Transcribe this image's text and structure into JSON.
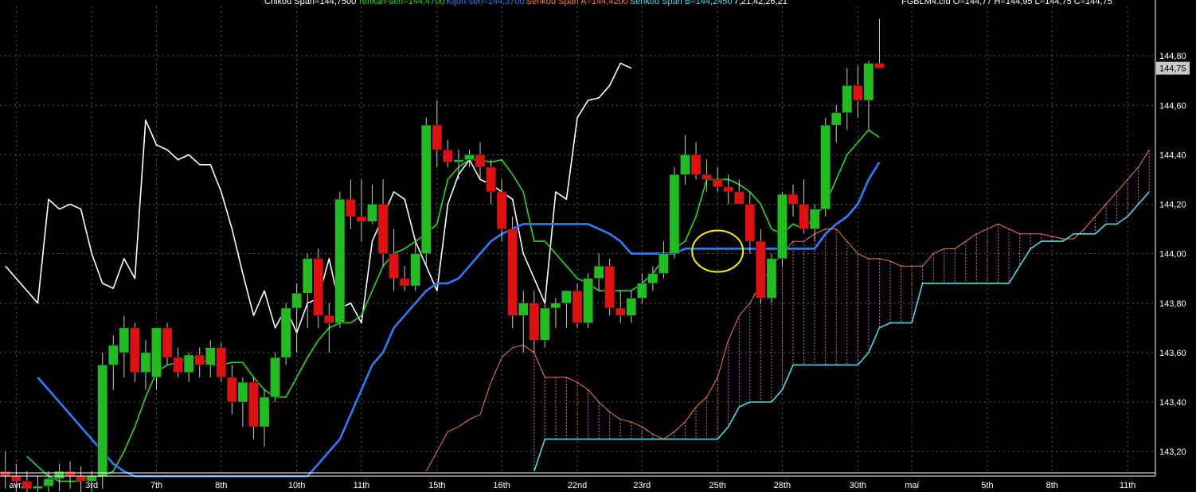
{
  "legend": {
    "chikou": "Chikou Span=144,7500",
    "tenkan": "Tenkan-sen=144,4700",
    "kijun": "Kijun-sen=144,3700",
    "senkou_a": "Senkou Span A=144,4200",
    "senkou_b": "Senkou Span B=144,2450",
    "params": "7,21,42,26,21",
    "ohlc": "FGBLM4.cfd O=144,77 H=144,95 L=144,75 C=144,75"
  },
  "last_price_label": "144,75",
  "colors": {
    "background": "#000000",
    "grid": "#5a5a5a",
    "chikou": "#ffffff",
    "tenkan": "#22dd22",
    "kijun": "#2a7fff",
    "senkou_a": "#ff7744",
    "senkou_b": "#44ddee",
    "cloud_fill": "#cc66cc",
    "candle_up": "#22bb22",
    "candle_down": "#dd1111",
    "highlight_circle": "#ffee00"
  },
  "chart_data": {
    "type": "candlestick",
    "y_tick_labels": [
      "144,80",
      "144,60",
      "144,40",
      "144,20",
      "144,00",
      "143,80",
      "143,60",
      "143,40",
      "143,20"
    ],
    "ylim": [
      143.12,
      145.0
    ],
    "x_tick_labels": [
      "avr.",
      "3rd",
      "7th",
      "8th",
      "10th",
      "11th",
      "15th",
      "16th",
      "22nd",
      "23rd",
      "25th",
      "28th",
      "30th",
      "mai",
      "5th",
      "8th",
      "11th"
    ],
    "x_tick_bar_index": [
      1,
      8,
      14,
      20,
      27,
      33,
      40,
      46,
      53,
      59,
      66,
      72,
      79,
      84,
      91,
      97,
      104
    ],
    "bar_count": 107,
    "grid": true,
    "candles": [
      [
        143.12,
        143.2,
        143.05,
        143.1
      ],
      [
        143.1,
        143.15,
        143.02,
        143.08
      ],
      [
        143.08,
        143.12,
        143.0,
        143.05
      ],
      [
        143.05,
        143.1,
        143.0,
        143.06
      ],
      [
        143.06,
        143.12,
        143.02,
        143.09
      ],
      [
        143.09,
        143.15,
        143.04,
        143.12
      ],
      [
        143.12,
        143.16,
        143.05,
        143.1
      ],
      [
        143.1,
        143.14,
        143.03,
        143.08
      ],
      [
        143.08,
        143.12,
        143.02,
        143.1
      ],
      [
        143.1,
        143.6,
        143.05,
        143.55
      ],
      [
        143.55,
        143.67,
        143.45,
        143.63
      ],
      [
        143.6,
        143.75,
        143.5,
        143.7
      ],
      [
        143.7,
        143.72,
        143.48,
        143.52
      ],
      [
        143.52,
        143.65,
        143.45,
        143.6
      ],
      [
        143.5,
        143.7,
        143.45,
        143.7
      ],
      [
        143.7,
        143.72,
        143.55,
        143.58
      ],
      [
        143.58,
        143.62,
        143.5,
        143.52
      ],
      [
        143.52,
        143.6,
        143.48,
        143.59
      ],
      [
        143.59,
        143.62,
        143.5,
        143.55
      ],
      [
        143.55,
        143.65,
        143.5,
        143.62
      ],
      [
        143.62,
        143.64,
        143.48,
        143.5
      ],
      [
        143.5,
        143.55,
        143.35,
        143.4
      ],
      [
        143.4,
        143.5,
        143.3,
        143.48
      ],
      [
        143.48,
        143.5,
        143.25,
        143.3
      ],
      [
        143.3,
        143.45,
        143.22,
        143.42
      ],
      [
        143.42,
        143.6,
        143.4,
        143.58
      ],
      [
        143.58,
        143.8,
        143.55,
        143.78
      ],
      [
        143.78,
        143.88,
        143.6,
        143.84
      ],
      [
        143.84,
        144.0,
        143.7,
        143.98
      ],
      [
        143.98,
        144.02,
        143.7,
        143.75
      ],
      [
        143.75,
        143.8,
        143.6,
        143.72
      ],
      [
        143.72,
        144.25,
        143.7,
        144.22
      ],
      [
        144.22,
        144.3,
        144.1,
        144.15
      ],
      [
        144.15,
        144.3,
        144.05,
        144.13
      ],
      [
        144.13,
        144.28,
        144.12,
        144.2
      ],
      [
        144.2,
        144.3,
        143.95,
        144.0
      ],
      [
        144.0,
        144.1,
        143.85,
        143.9
      ],
      [
        143.9,
        143.95,
        143.85,
        143.87
      ],
      [
        143.87,
        144.05,
        143.85,
        144.0
      ],
      [
        144.0,
        144.55,
        143.95,
        144.52
      ],
      [
        144.52,
        144.62,
        144.35,
        144.42
      ],
      [
        144.42,
        144.46,
        144.35,
        144.37
      ],
      [
        144.37,
        144.42,
        144.3,
        144.38
      ],
      [
        144.38,
        144.42,
        144.35,
        144.4
      ],
      [
        144.4,
        144.45,
        144.3,
        144.35
      ],
      [
        144.35,
        144.38,
        144.2,
        144.25
      ],
      [
        144.25,
        144.3,
        144.05,
        144.1
      ],
      [
        144.1,
        144.15,
        143.7,
        143.75
      ],
      [
        143.75,
        143.85,
        143.6,
        143.8
      ],
      [
        143.8,
        143.85,
        143.6,
        143.65
      ],
      [
        143.65,
        143.8,
        143.62,
        143.78
      ],
      [
        143.78,
        143.82,
        143.7,
        143.8
      ],
      [
        143.8,
        143.85,
        143.7,
        143.85
      ],
      [
        143.85,
        143.88,
        143.7,
        143.72
      ],
      [
        143.72,
        143.92,
        143.7,
        143.9
      ],
      [
        143.9,
        144.0,
        143.85,
        143.95
      ],
      [
        143.95,
        143.98,
        143.75,
        143.78
      ],
      [
        143.78,
        143.85,
        143.72,
        143.75
      ],
      [
        143.75,
        143.85,
        143.72,
        143.82
      ],
      [
        143.82,
        143.92,
        143.8,
        143.88
      ],
      [
        143.88,
        143.95,
        143.85,
        143.92
      ],
      [
        143.92,
        144.05,
        143.9,
        144.0
      ],
      [
        144.0,
        144.35,
        143.98,
        144.32
      ],
      [
        144.32,
        144.48,
        144.28,
        144.4
      ],
      [
        144.4,
        144.45,
        144.3,
        144.32
      ],
      [
        144.32,
        144.38,
        144.25,
        144.3
      ],
      [
        144.3,
        144.35,
        144.25,
        144.27
      ],
      [
        144.27,
        144.32,
        144.2,
        144.25
      ],
      [
        144.25,
        144.3,
        144.2,
        144.2
      ],
      [
        144.2,
        144.25,
        144.0,
        144.05
      ],
      [
        144.05,
        144.1,
        143.8,
        143.82
      ],
      [
        143.82,
        144.0,
        143.8,
        143.98
      ],
      [
        143.98,
        144.25,
        143.95,
        144.24
      ],
      [
        144.24,
        144.28,
        144.15,
        144.2
      ],
      [
        144.2,
        144.3,
        144.08,
        144.1
      ],
      [
        144.1,
        144.2,
        144.05,
        144.18
      ],
      [
        144.18,
        144.55,
        144.15,
        144.52
      ],
      [
        144.52,
        144.6,
        144.45,
        144.57
      ],
      [
        144.57,
        144.75,
        144.5,
        144.68
      ],
      [
        144.68,
        144.76,
        144.55,
        144.62
      ],
      [
        144.62,
        144.78,
        144.5,
        144.77
      ],
      [
        144.77,
        144.95,
        144.75,
        144.75
      ]
    ],
    "series": [
      {
        "name": "Chikou Span",
        "values": [
          143.95,
          143.9,
          143.85,
          143.8,
          144.22,
          144.18,
          144.2,
          144.18,
          144.0,
          143.88,
          143.86,
          143.98,
          143.9,
          144.54,
          144.44,
          144.42,
          144.38,
          144.4,
          144.36,
          144.36,
          144.25,
          144.1,
          143.92,
          143.75,
          143.85,
          143.7,
          143.78,
          143.68,
          143.8,
          143.82,
          143.98,
          143.78,
          143.8,
          143.72,
          144.05,
          144.15,
          144.25,
          144.22,
          144.05,
          143.95,
          143.85,
          144.2,
          144.32,
          144.38,
          144.3,
          144.28,
          144.25,
          144.22,
          144.0,
          143.9,
          143.8,
          144.25,
          144.22,
          144.55,
          144.62,
          144.63,
          144.68,
          144.77,
          144.75
        ]
      },
      {
        "name": "Tenkan-sen",
        "values": [
          143.18,
          143.14,
          143.1,
          143.08,
          143.08,
          143.08,
          143.1,
          143.1,
          143.12,
          143.2,
          143.3,
          143.42,
          143.52,
          143.55,
          143.56,
          143.58,
          143.58,
          143.55,
          143.55,
          143.56,
          143.56,
          143.5,
          143.45,
          143.42,
          143.42,
          143.5,
          143.58,
          143.65,
          143.7,
          143.72,
          143.72,
          143.75,
          143.85,
          143.95,
          144.0,
          144.02,
          144.05,
          144.08,
          144.12,
          144.3,
          144.35,
          144.38,
          144.38,
          144.37,
          144.38,
          144.32,
          144.25,
          144.05,
          144.05,
          144.0,
          143.95,
          143.9,
          143.88,
          143.85,
          143.85,
          143.85,
          143.85,
          143.88,
          143.92,
          143.98,
          144.02,
          144.05,
          144.15,
          144.3,
          144.3,
          144.3,
          144.28,
          144.25,
          144.2,
          144.1,
          144.08,
          144.12,
          144.1,
          144.15,
          144.2,
          144.3,
          144.4,
          144.45,
          144.5,
          144.47
        ]
      },
      {
        "name": "Kijun-sen",
        "values": [
          143.5,
          143.45,
          143.4,
          143.35,
          143.3,
          143.25,
          143.2,
          143.15,
          143.12,
          143.1,
          143.1,
          143.1,
          143.1,
          143.1,
          143.1,
          143.1,
          143.1,
          143.1,
          143.1,
          143.1,
          143.1,
          143.1,
          143.1,
          143.1,
          143.1,
          143.1,
          143.15,
          143.2,
          143.25,
          143.35,
          143.45,
          143.55,
          143.6,
          143.7,
          143.75,
          143.8,
          143.85,
          143.88,
          143.88,
          143.9,
          143.95,
          144.0,
          144.05,
          144.08,
          144.1,
          144.12,
          144.12,
          144.12,
          144.12,
          144.12,
          144.12,
          144.12,
          144.1,
          144.08,
          144.05,
          144.0,
          144.0,
          144.0,
          144.0,
          144.0,
          144.02,
          144.02,
          144.02,
          144.02,
          144.02,
          144.02,
          144.02,
          144.02,
          144.02,
          144.02,
          144.02,
          144.02,
          144.02,
          144.08,
          144.12,
          144.15,
          144.2,
          144.3,
          144.37
        ]
      },
      {
        "name": "Senkou Span A",
        "values": [
          143.12,
          143.2,
          143.28,
          143.3,
          143.33,
          143.35,
          143.48,
          143.58,
          143.62,
          143.63,
          143.6,
          143.5,
          143.5,
          143.5,
          143.48,
          143.45,
          143.4,
          143.36,
          143.33,
          143.32,
          143.3,
          143.27,
          143.25,
          143.28,
          143.32,
          143.38,
          143.42,
          143.5,
          143.65,
          143.75,
          143.8,
          143.88,
          143.95,
          144.0,
          144.05,
          144.05,
          144.08,
          144.1,
          144.1,
          144.05,
          144.0,
          143.98,
          143.98,
          143.97,
          143.95,
          143.95,
          143.95,
          144.0,
          144.02,
          144.02,
          144.05,
          144.08,
          144.1,
          144.12,
          144.1,
          144.08,
          144.08,
          144.08,
          144.07,
          144.06,
          144.06,
          144.1,
          144.15,
          144.2,
          144.25,
          144.3,
          144.35,
          144.42
        ]
      },
      {
        "name": "Senkou Span B",
        "values": [
          143.12,
          143.25,
          143.25,
          143.25,
          143.25,
          143.25,
          143.25,
          143.25,
          143.25,
          143.25,
          143.25,
          143.25,
          143.25,
          143.25,
          143.25,
          143.25,
          143.25,
          143.25,
          143.3,
          143.38,
          143.4,
          143.4,
          143.4,
          143.45,
          143.55,
          143.55,
          143.55,
          143.55,
          143.55,
          143.55,
          143.55,
          143.6,
          143.7,
          143.72,
          143.72,
          143.72,
          143.88,
          143.88,
          143.88,
          143.88,
          143.88,
          143.88,
          143.88,
          143.88,
          143.88,
          143.95,
          144.02,
          144.05,
          144.05,
          144.05,
          144.08,
          144.08,
          144.08,
          144.12,
          144.12,
          144.15,
          144.2,
          144.25
        ]
      }
    ],
    "annotations": [
      {
        "type": "circle",
        "x_bar_index": 66,
        "y": 144.01
      }
    ]
  }
}
